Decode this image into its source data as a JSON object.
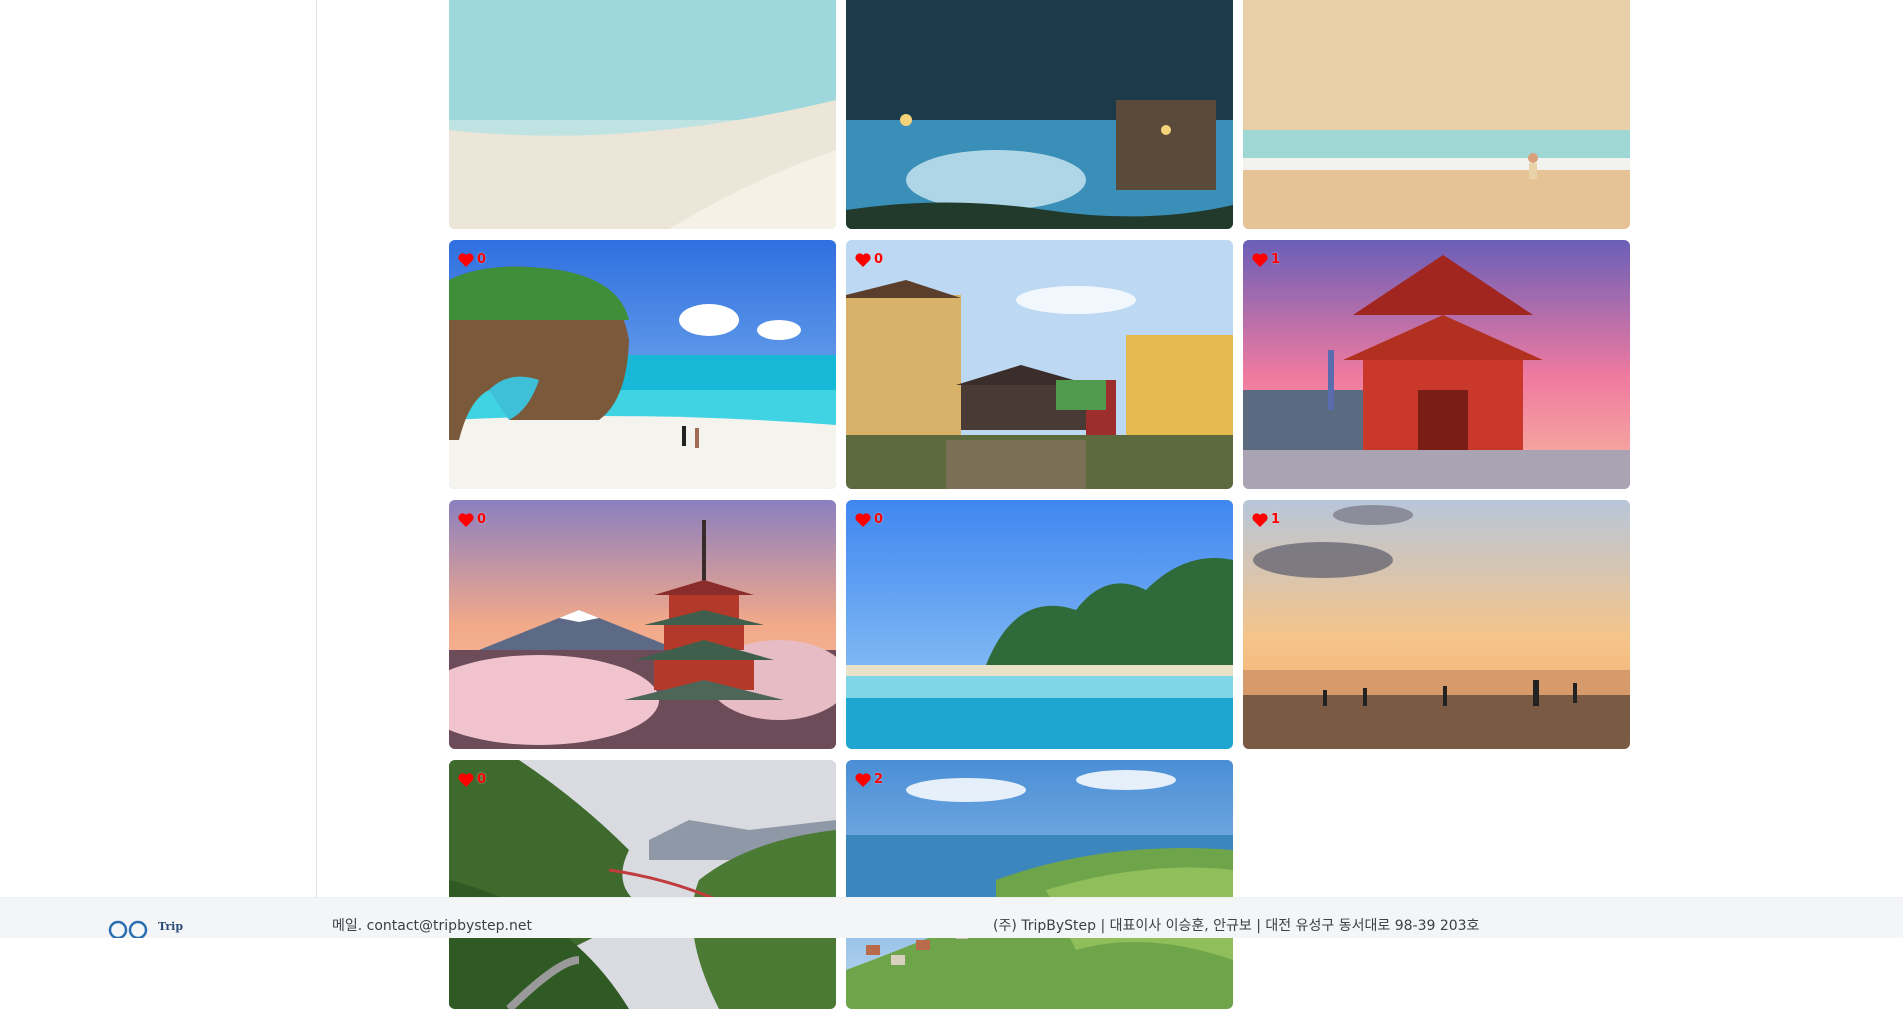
{
  "gallery": {
    "cards": [
      {
        "scene": "white-sand-beach",
        "likes": null
      },
      {
        "scene": "night-reflection-pool",
        "likes": null
      },
      {
        "scene": "beach-girl-walking",
        "likes": null
      },
      {
        "scene": "rock-arch-beach",
        "likes": "0"
      },
      {
        "scene": "hoi-an-japanese-bridge",
        "likes": "0"
      },
      {
        "scene": "senso-ji-gate-tokyo",
        "likes": "1"
      },
      {
        "scene": "chureito-pagoda-fuji",
        "likes": "0"
      },
      {
        "scene": "tropical-island-lagoon",
        "likes": "0"
      },
      {
        "scene": "sunset-beach-crowd",
        "likes": "1"
      },
      {
        "scene": "forest-suspension-bridge",
        "likes": "0"
      },
      {
        "scene": "lake-vineyard-village",
        "likes": "2"
      }
    ]
  },
  "colors": {
    "heart": "#ff0000",
    "footer_bg": "#f4f5f7"
  },
  "footer": {
    "logo_text": "Trip",
    "email": "메일. contact@tripbystep.net",
    "company": "(주) TripByStep | 대표이사 이승훈, 안규보 | 대전 유성구 동서대로 98-39 203호"
  }
}
